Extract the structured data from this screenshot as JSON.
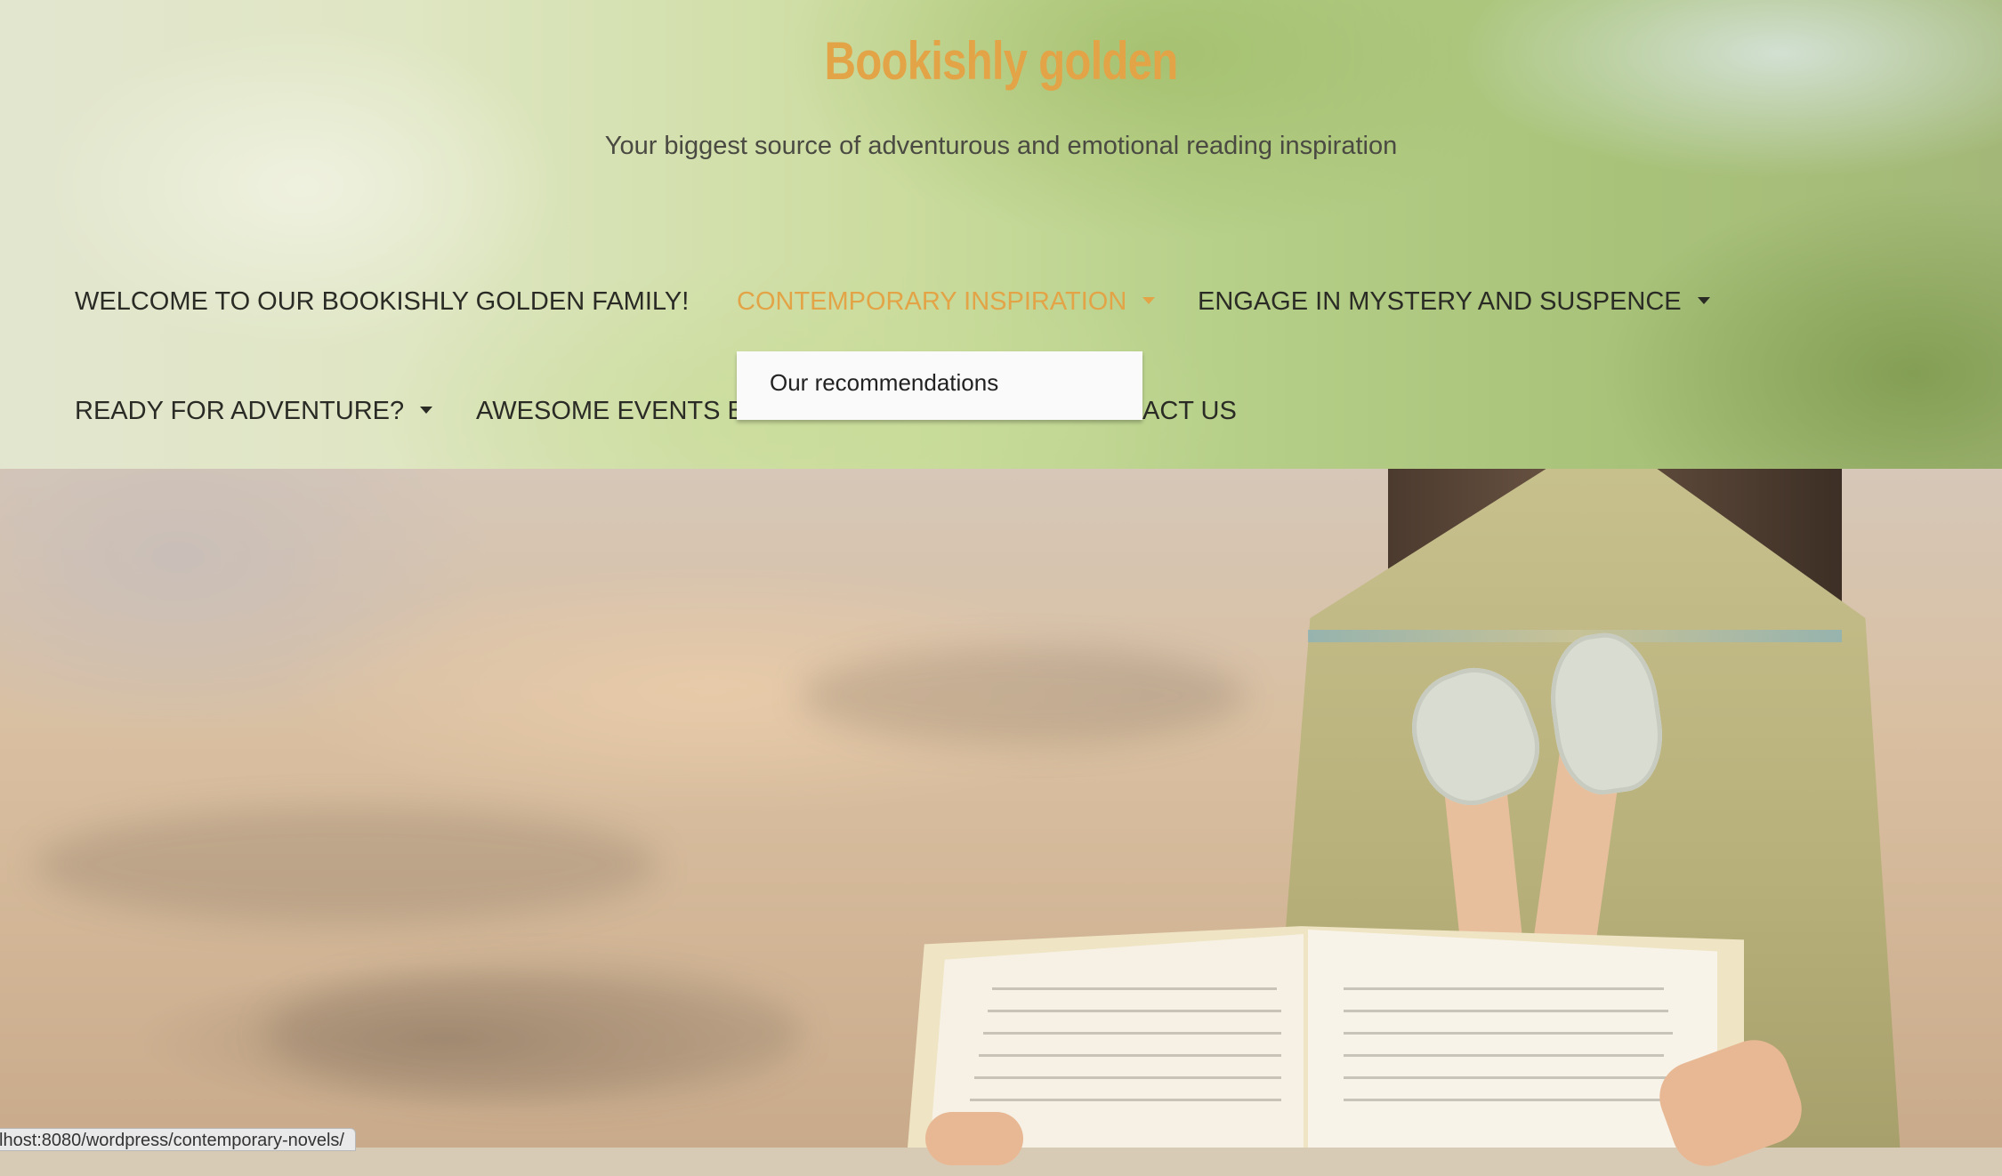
{
  "site": {
    "title": "Bookishly golden",
    "tagline": "Your biggest source of adventurous and emotional reading inspiration"
  },
  "nav": {
    "items": [
      {
        "label": "WELCOME TO OUR BOOKISHLY GOLDEN FAMILY!",
        "has_submenu": false
      },
      {
        "label": "CONTEMPORARY INSPIRATION",
        "has_submenu": true,
        "active": true
      },
      {
        "label": "ENGAGE IN MYSTERY AND SUSPENCE",
        "has_submenu": true
      },
      {
        "label": "READY FOR ADVENTURE?",
        "has_submenu": true
      },
      {
        "label": "AWESOME EVENTS BY",
        "has_submenu": false
      },
      {
        "label": "ACT US",
        "has_submenu": false
      }
    ],
    "dropdown": {
      "items": [
        "Our recommendations"
      ]
    }
  },
  "status_bar": {
    "url_text": "lhost:8080/wordpress/contemporary-novels/"
  },
  "colors": {
    "accent": "#e3a447",
    "nav_text": "#2b2b26",
    "tagline": "#4a4a42"
  }
}
